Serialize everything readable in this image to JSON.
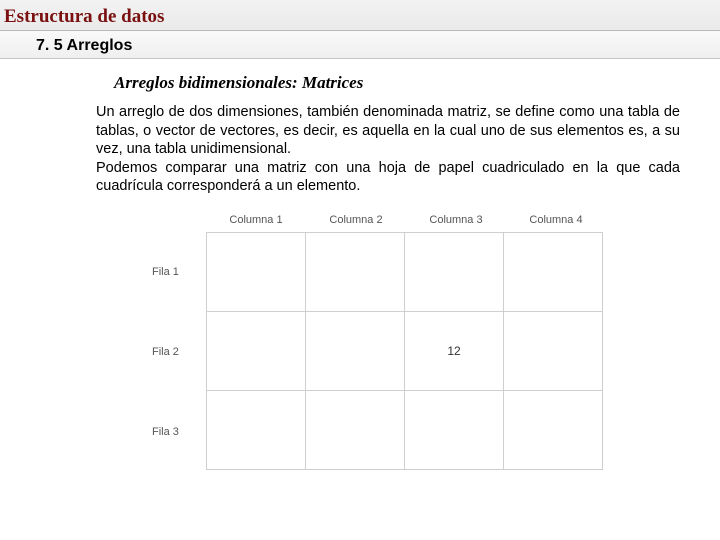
{
  "page_title": "Estructura de datos",
  "section_title": "7. 5 Arreglos",
  "sub_title": "Arreglos bidimensionales: Matrices",
  "paragraph": "Un arreglo de dos dimensiones, también denominada matriz, se define como una tabla de tablas, o vector de vectores, es decir, es aquella en la cual uno de sus elementos es,  a su vez, una tabla unidimensional.\nPodemos comparar una matriz con una hoja de papel cuadriculado en la que cada cuadrícula corresponderá a un elemento.",
  "matrix": {
    "columns": [
      "Columna 1",
      "Columna 2",
      "Columna 3",
      "Columna 4"
    ],
    "rows": [
      "Fila 1",
      "Fila 2",
      "Fila 3"
    ],
    "cells": [
      [
        "",
        "",
        "",
        ""
      ],
      [
        "",
        "",
        "12",
        ""
      ],
      [
        "",
        "",
        "",
        ""
      ]
    ]
  }
}
